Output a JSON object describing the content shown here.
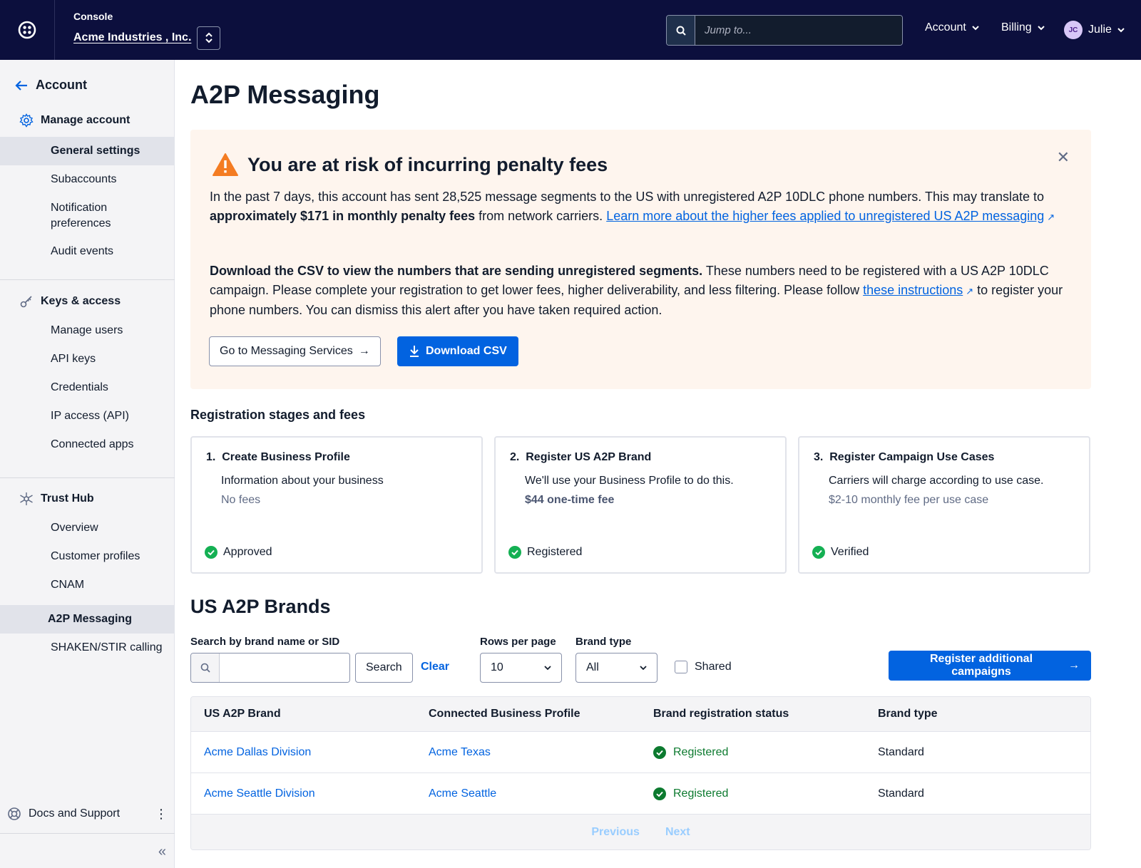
{
  "topbar": {
    "console_label": "Console",
    "account_name": "Acme Industries , Inc.",
    "jump_placeholder": "Jump to...",
    "menu_account": "Account",
    "menu_billing": "Billing",
    "user_initials": "JC",
    "user_name": "Julie"
  },
  "sidebar": {
    "back_label": "Account",
    "sections": [
      {
        "label": "Manage account",
        "items": [
          "General settings",
          "Subaccounts",
          "Notification preferences",
          "Audit events"
        ]
      },
      {
        "label": "Keys & access",
        "items": [
          "Manage users",
          "API keys",
          "Credentials",
          "IP access (API)",
          "Connected apps"
        ]
      },
      {
        "label": "Trust Hub",
        "items": [
          "Overview",
          "Customer profiles",
          "CNAM",
          "A2P Messaging",
          "SHAKEN/STIR calling"
        ]
      }
    ],
    "notif_line1": "Notification",
    "notif_line2": "preferences",
    "docs_label": "Docs and Support"
  },
  "page": {
    "title": "A2P Messaging"
  },
  "alert": {
    "title": "You are at risk of incurring penalty fees",
    "p1_text_a": "In the past 7 days, this account has sent 28,525 message segments to the US with unregistered A2P 10DLC phone numbers. This may translate to ",
    "p1_bold": "approximately $171 in monthly penalty fees",
    "p1_text_b": " from network carriers. ",
    "p1_link": "Learn more about the higher fees applied to unregistered US A2P messaging",
    "p2_bold": "Download the CSV to view the numbers that are sending unregistered segments.",
    "p2_text_a": " These numbers need to be registered with a US A2P 10DLC campaign. Please complete your registration to get lower fees, higher deliverability, and less filtering. Please follow ",
    "p2_link": "these instructions",
    "p2_text_b": " to register your phone numbers. You can dismiss this alert after you have taken required action.",
    "btn_services": "Go to Messaging Services",
    "btn_download": "Download CSV"
  },
  "stages": {
    "heading": "Registration stages and fees",
    "items": [
      {
        "num": "1.",
        "title": "Create Business Profile",
        "desc": "Information about your business",
        "fee": "No fees",
        "status": "Approved"
      },
      {
        "num": "2.",
        "title": "Register US A2P Brand",
        "desc": "We'll use your Business Profile to do this.",
        "fee": "$44 one-time fee",
        "status": "Registered"
      },
      {
        "num": "3.",
        "title": "Register Campaign Use Cases",
        "desc": "Carriers will charge according to use case.",
        "fee": "$2-10 monthly fee per use case",
        "status": "Verified"
      }
    ]
  },
  "brands": {
    "heading": "US A2P Brands",
    "search_label": "Search by brand name or SID",
    "search_button": "Search",
    "clear": "Clear",
    "rows_label": "Rows per page",
    "rows_value": "10",
    "type_label": "Brand type",
    "type_value": "All",
    "shared_label": "Shared",
    "register_button": "Register additional campaigns",
    "columns": [
      "US A2P Brand",
      "Connected Business Profile",
      "Brand registration status",
      "Brand type"
    ],
    "rows": [
      {
        "brand": "Acme Dallas Division",
        "profile": "Acme Texas",
        "status": "Registered",
        "type": "Standard"
      },
      {
        "brand": "Acme Seattle Division",
        "profile": "Acme Seattle",
        "status": "Registered",
        "type": "Standard"
      }
    ],
    "prev": "Previous",
    "next": "Next"
  },
  "colors": {
    "topbar": "#0c0f3d",
    "primary": "#0263e0",
    "alert_bg": "#fef5ee",
    "warning": "#f47c22",
    "success": "#14b053"
  }
}
